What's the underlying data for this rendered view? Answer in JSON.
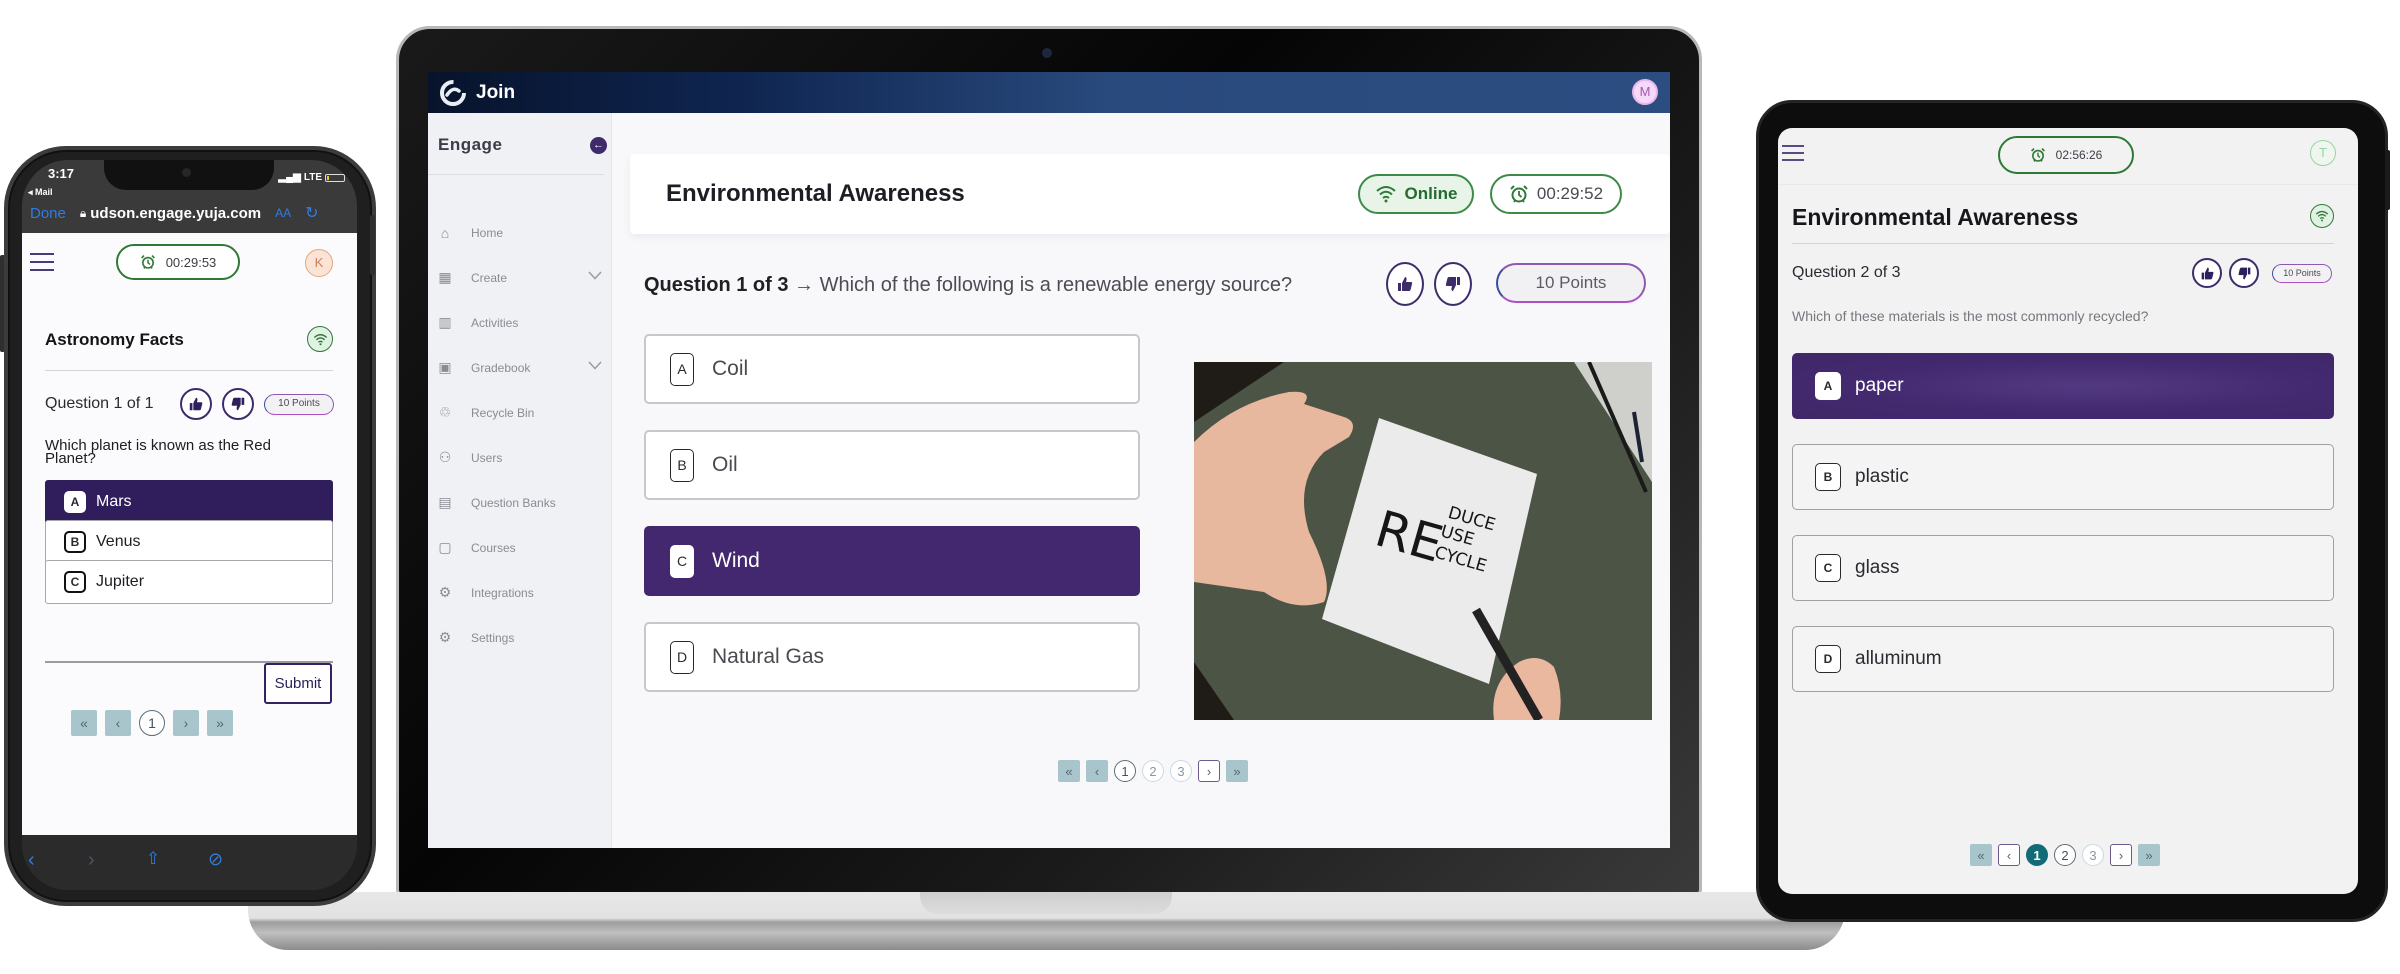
{
  "laptop": {
    "app": {
      "brand": "Join",
      "avatar_initial": "M"
    },
    "sidebar": {
      "title": "Engage",
      "items": [
        {
          "label": "Home",
          "icon": "home-icon",
          "expandable": false
        },
        {
          "label": "Create",
          "icon": "create-icon",
          "expandable": true
        },
        {
          "label": "Activities",
          "icon": "bar-chart-icon",
          "expandable": false
        },
        {
          "label": "Gradebook",
          "icon": "gradebook-icon",
          "expandable": true
        },
        {
          "label": "Recycle Bin",
          "icon": "recycle-icon",
          "expandable": false
        },
        {
          "label": "Users",
          "icon": "users-icon",
          "expandable": false
        },
        {
          "label": "Question Banks",
          "icon": "question-bank-icon",
          "expandable": false
        },
        {
          "label": "Courses",
          "icon": "courses-icon",
          "expandable": false
        },
        {
          "label": "Integrations",
          "icon": "integrations-icon",
          "expandable": false
        },
        {
          "label": "Settings",
          "icon": "settings-icon",
          "expandable": false
        }
      ]
    },
    "quiz": {
      "title": "Environmental Awareness",
      "status": "Online",
      "timer": "00:29:52",
      "question_prefix": "Question 1 of 3",
      "arrow": "→",
      "question_text": "Which of the following is a renewable energy source?",
      "points": "10 Points",
      "options": [
        {
          "letter": "A",
          "text": "Coil",
          "selected": false
        },
        {
          "letter": "B",
          "text": "Oil",
          "selected": false
        },
        {
          "letter": "C",
          "text": "Wind",
          "selected": true
        },
        {
          "letter": "D",
          "text": "Natural Gas",
          "selected": false
        }
      ],
      "image": {
        "alt": "Hands writing REDUCE REUSE RECYCLE on paper",
        "note_big": "RE",
        "note_lines": [
          "DUCE",
          "USE",
          "CYCLE"
        ]
      },
      "pagination": {
        "first": "«",
        "prev": "‹",
        "pages": [
          "1",
          "2",
          "3"
        ],
        "current": "1",
        "next": "›",
        "last": "»"
      }
    }
  },
  "phone": {
    "status_bar": {
      "time": "3:17",
      "back_app": "◂ Mail",
      "network": "LTE"
    },
    "browser": {
      "done": "Done",
      "url": "udson.engage.yuja.com",
      "text_size": "AA"
    },
    "quiz": {
      "timer": "00:29:53",
      "avatar_initial": "K",
      "title": "Astronomy Facts",
      "question_number": "Question 1 of 1",
      "points": "10 Points",
      "question_text": "Which planet is known as the Red Planet?",
      "options": [
        {
          "letter": "A",
          "text": "Mars",
          "selected": true
        },
        {
          "letter": "B",
          "text": "Venus",
          "selected": false
        },
        {
          "letter": "C",
          "text": "Jupiter",
          "selected": false
        }
      ],
      "submit": "Submit",
      "pagination": {
        "first": "«",
        "prev": "‹",
        "pages": [
          "1"
        ],
        "current": "1",
        "next": "›",
        "last": "»"
      }
    }
  },
  "tablet": {
    "quiz": {
      "timer": "02:56:26",
      "avatar_initial": "T",
      "title": "Environmental Awareness",
      "question_number": "Question 2 of 3",
      "points": "10 Points",
      "question_text": "Which of these materials is the most commonly recycled?",
      "options": [
        {
          "letter": "A",
          "text": "paper",
          "selected": true
        },
        {
          "letter": "B",
          "text": "plastic",
          "selected": false
        },
        {
          "letter": "C",
          "text": "glass",
          "selected": false
        },
        {
          "letter": "D",
          "text": "alluminum",
          "selected": false
        }
      ],
      "pagination": {
        "first": "«",
        "prev": "‹",
        "pages": [
          "1",
          "2",
          "3"
        ],
        "current": "1",
        "next": "›",
        "last": "»"
      }
    }
  },
  "colors": {
    "accent_purple": "#43286f",
    "online_green": "#3c8a46",
    "pager_teal": "#136b77",
    "pager_inactive": "#a9c5cc",
    "topbar_navy": "#0f2550"
  }
}
